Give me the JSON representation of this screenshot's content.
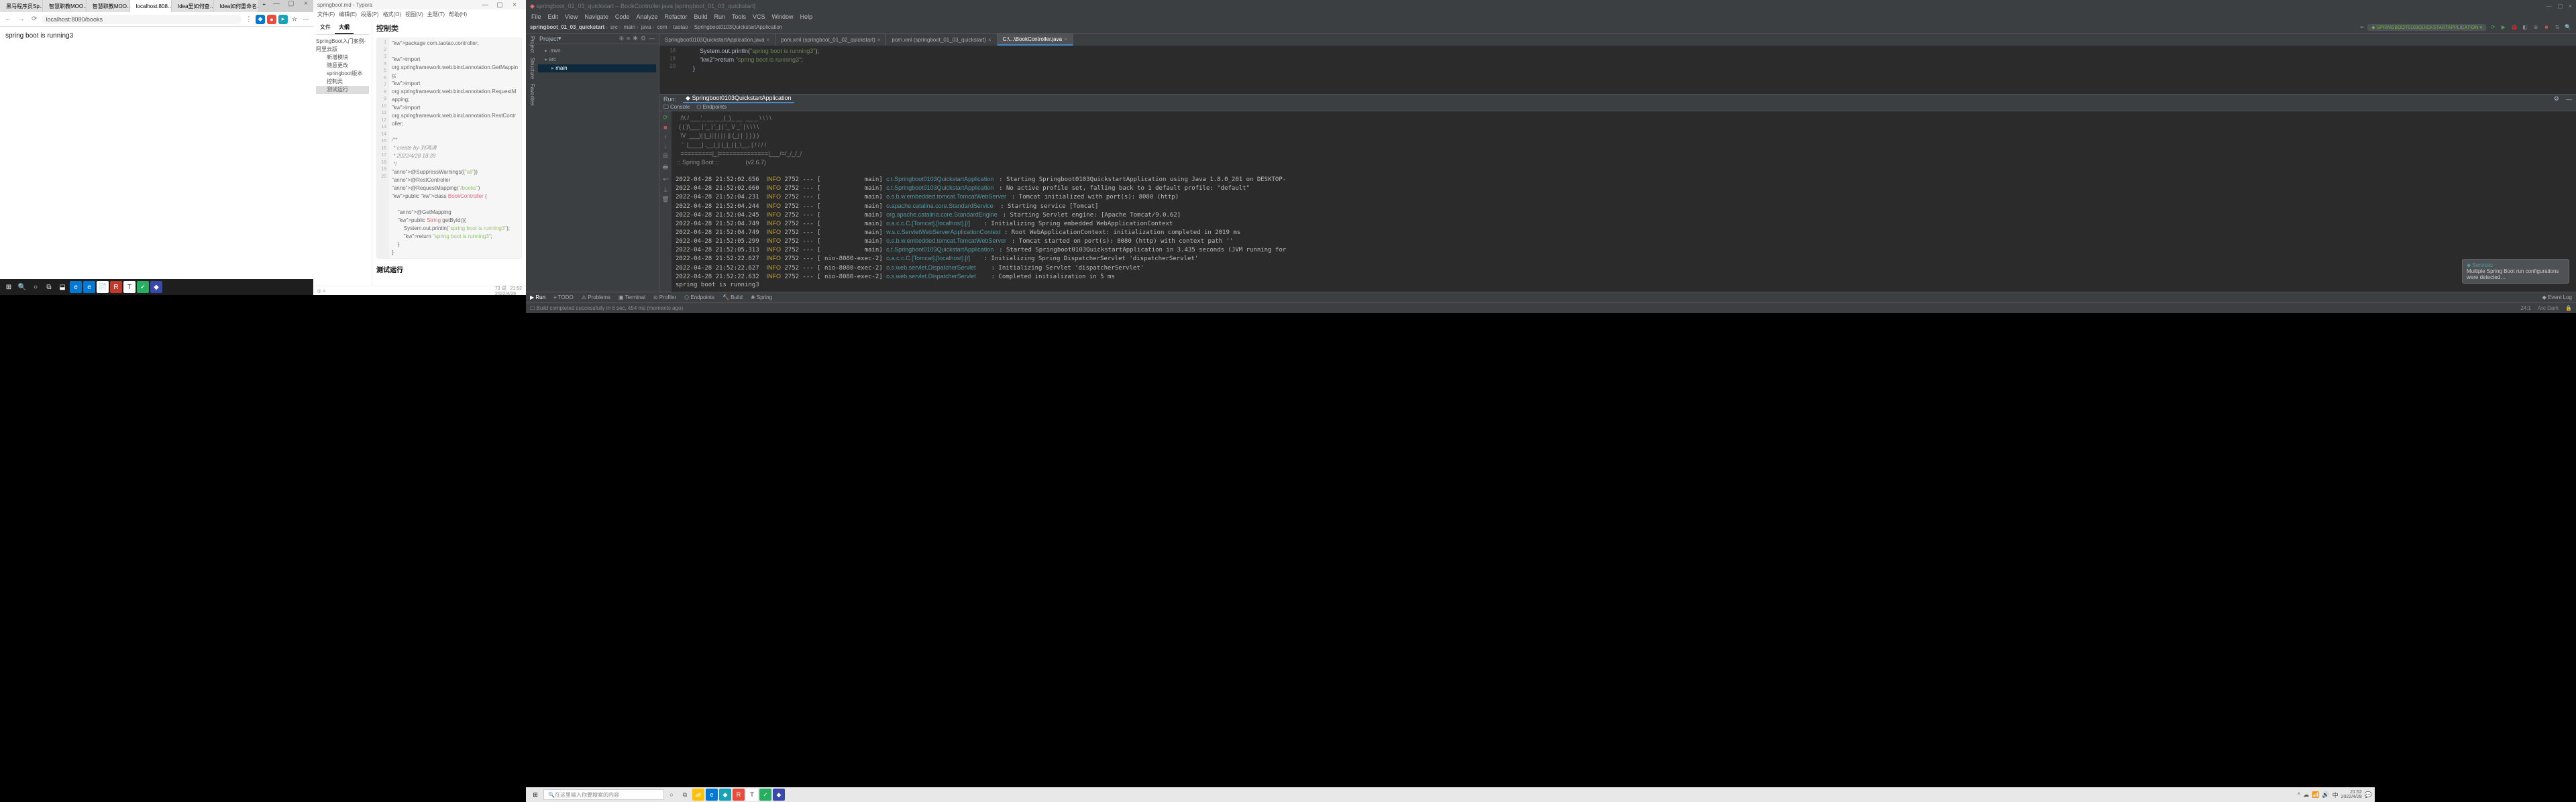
{
  "browser": {
    "tabs": [
      "黑马程序员Sp…",
      "智慧职教MOO…",
      "智慧职教MOO…",
      "localhost:808…",
      "Idea里如何查…",
      "Idea如何重命名…"
    ],
    "active_tab_index": 3,
    "url": "localhost:8080/books",
    "content": "spring boot is running3"
  },
  "taskbar_left": {
    "icons": [
      "win",
      "search",
      "cortana",
      "taskview",
      "people",
      "edge",
      "edge2",
      "note",
      "red",
      "T",
      "green",
      "blue",
      "app"
    ]
  },
  "typora": {
    "title": "springboot.md - Typora",
    "menu": [
      "文件(F)",
      "编辑(E)",
      "段落(P)",
      "格式(O)",
      "视图(V)",
      "主题(T)",
      "帮助(H)"
    ],
    "sidebar_tabs": [
      "文件",
      "大纲"
    ],
    "sidebar_active": 1,
    "outline": {
      "root": "SpringBoot入门案例-阿里云版",
      "children": [
        "新增模块",
        "随意更改springboot版本",
        "控制类",
        "测试运行"
      ],
      "selected": 3
    },
    "heading1": "控制类",
    "code_lines": [
      "package com.taotao.controller;",
      "",
      "import",
      "org.springframework.web.bind.annotation.GetMapping;",
      "import",
      "org.springframework.web.bind.annotation.RequestMapping;",
      "import",
      "org.springframework.web.bind.annotation.RestController;",
      "",
      "/**",
      " * create by 刘鸿涛",
      " * 2022/4/28 18:39",
      " */",
      "@SuppressWarnings({\"all\"})",
      "@RestController",
      "@RequestMapping(\"/books\")",
      "public class BookController {",
      "",
      "    @GetMapping",
      "    public String getById(){",
      "        System.out.println(\"spring boot is running3\");",
      "        return \"spring boot is running3\";",
      "    }",
      "}"
    ],
    "heading2": "测试运行",
    "status_left": "◎ >",
    "status_right_words": "73 词",
    "status_clock": "21:52\n2022/4/28"
  },
  "idea": {
    "title_extra": "springboot_01_03_quickstart – BookController.java [springboot_01_03_quickstart]",
    "menu": [
      "File",
      "Edit",
      "View",
      "Navigate",
      "Code",
      "Analyze",
      "Refactor",
      "Build",
      "Run",
      "Tools",
      "VCS",
      "Window",
      "Help"
    ],
    "breadcrumb": [
      "springboot_01_03_quickstart",
      "src",
      "main",
      "java",
      "com",
      "taotao",
      "Springboot0103QuickstartApplication"
    ],
    "run_config": "SPRINGBOOT0103QUICKSTARTAPPLICATION",
    "project_header": "Project",
    "project_tree": [
      ".mvn",
      "src",
      "main"
    ],
    "editor_tabs": [
      "Springboot0103QuickstartApplication.java",
      "pom.xml (springboot_01_02_quickstart)",
      "pom.xml (springboot_01_03_quickstart)",
      "C:\\...\\BookController.java"
    ],
    "editor_active": 3,
    "editor_lines": {
      "18": "            System.out.println(\"spring boot is running3\");",
      "19": "            return \"spring boot is running3\";",
      "20": "        }"
    },
    "run_tab_label": "Run:",
    "run_tab_app": "Springboot0103QuickstartApplication",
    "run_subtabs": [
      "Console",
      "Endpoints"
    ],
    "console_ascii": "   /\\\\ / ___'_ __ _ _(_)_ __  __ _ \\ \\ \\ \\ \n  ( ( )\\___ | '_ | '_| | '_ \\/ _` | \\ \\ \\ \\ \n   \\\\/  ___)| |_)| | | | | || (_| |  ) ) ) )\n    '  |____| .__|_| |_|_| |_\\__, | / / / /\n   =========|_|==============|___/=/_/_/_/",
    "console_banner": " :: Spring Boot ::                (v2.6.7)",
    "console_log": [
      {
        "ts": "2022-04-28 21:52:02.656",
        "lvl": "INFO",
        "pid": "2752",
        "th": "main",
        "logger": "c.t.Springboot0103QuickstartApplication",
        "msg": "Starting Springboot0103QuickstartApplication using Java 1.8.0_201 on DESKTOP-"
      },
      {
        "ts": "2022-04-28 21:52:02.660",
        "lvl": "INFO",
        "pid": "2752",
        "th": "main",
        "logger": "c.t.Springboot0103QuickstartApplication",
        "msg": "No active profile set, falling back to 1 default profile: \"default\""
      },
      {
        "ts": "2022-04-28 21:52:04.231",
        "lvl": "INFO",
        "pid": "2752",
        "th": "main",
        "logger": "o.s.b.w.embedded.tomcat.TomcatWebServer",
        "msg": "Tomcat initialized with port(s): 8080 (http)"
      },
      {
        "ts": "2022-04-28 21:52:04.244",
        "lvl": "INFO",
        "pid": "2752",
        "th": "main",
        "logger": "o.apache.catalina.core.StandardService",
        "msg": "Starting service [Tomcat]"
      },
      {
        "ts": "2022-04-28 21:52:04.245",
        "lvl": "INFO",
        "pid": "2752",
        "th": "main",
        "logger": "org.apache.catalina.core.StandardEngine",
        "msg": "Starting Servlet engine: [Apache Tomcat/9.0.62]"
      },
      {
        "ts": "2022-04-28 21:52:04.749",
        "lvl": "INFO",
        "pid": "2752",
        "th": "main",
        "logger": "o.a.c.c.C.[Tomcat].[localhost].[/]",
        "msg": "Initializing Spring embedded WebApplicationContext"
      },
      {
        "ts": "2022-04-28 21:52:04.749",
        "lvl": "INFO",
        "pid": "2752",
        "th": "main",
        "logger": "w.s.c.ServletWebServerApplicationContext",
        "msg": "Root WebApplicationContext: initialization completed in 2019 ms"
      },
      {
        "ts": "2022-04-28 21:52:05.299",
        "lvl": "INFO",
        "pid": "2752",
        "th": "main",
        "logger": "o.s.b.w.embedded.tomcat.TomcatWebServer",
        "msg": "Tomcat started on port(s): 8080 (http) with context path ''"
      },
      {
        "ts": "2022-04-28 21:52:05.313",
        "lvl": "INFO",
        "pid": "2752",
        "th": "main",
        "logger": "c.t.Springboot0103QuickstartApplication",
        "msg": "Started Springboot0103QuickstartApplication in 3.435 seconds (JVM running for"
      },
      {
        "ts": "2022-04-28 21:52:22.627",
        "lvl": "INFO",
        "pid": "2752",
        "th": "nio-8080-exec-2",
        "logger": "o.a.c.c.C.[Tomcat].[localhost].[/]",
        "msg": "Initializing Spring DispatcherServlet 'dispatcherServlet'"
      },
      {
        "ts": "2022-04-28 21:52:22.627",
        "lvl": "INFO",
        "pid": "2752",
        "th": "nio-8080-exec-2",
        "logger": "o.s.web.servlet.DispatcherServlet",
        "msg": "Initializing Servlet 'dispatcherServlet'"
      },
      {
        "ts": "2022-04-28 21:52:22.632",
        "lvl": "INFO",
        "pid": "2752",
        "th": "nio-8080-exec-2",
        "logger": "o.s.web.servlet.DispatcherServlet",
        "msg": "Completed initialization in 5 ms"
      }
    ],
    "console_tail": "spring boot is running3",
    "bottom_tabs": [
      "Run",
      "TODO",
      "Problems",
      "Terminal",
      "Profiler",
      "Endpoints",
      "Build",
      "Spring"
    ],
    "bottom_right": "Event Log",
    "status_msg": "Build completed successfully in 6 sec, 454 ms (moments ago)",
    "status_right": [
      "24:1",
      "Arc Dark"
    ],
    "notif_title": "Services",
    "notif_body": "Multiple Spring Boot run configurations were detected…"
  },
  "taskbar_right": {
    "search_placeholder": "在这里输入你要搜索的内容",
    "clock_time": "21:52",
    "clock_date": "2022/4/28"
  }
}
